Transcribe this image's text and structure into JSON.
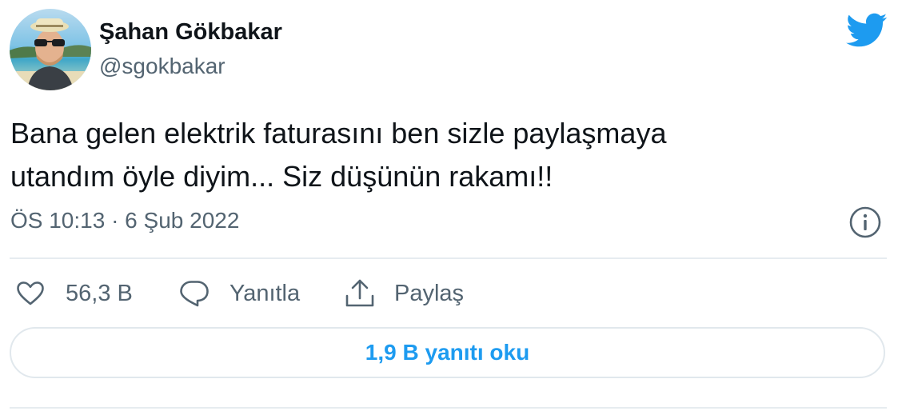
{
  "user": {
    "display_name": "Şahan Gökbakar",
    "handle": "@sgokbakar"
  },
  "tweet": {
    "text_lines": [
      "Bana gelen elektrik faturasını ben sizle paylaşmaya",
      "utandım öyle diyim... Siz düşünün rakamı!!"
    ],
    "timestamp": "ÖS 10:13 · 6 Şub 2022"
  },
  "actions": {
    "like_count": "56,3 B",
    "reply_label": "Yanıtla",
    "share_label": "Paylaş"
  },
  "read_replies_label": "1,9 B yanıtı oku",
  "colors": {
    "twitter_blue": "#1d9bf0",
    "text_primary": "#0f1419",
    "text_secondary": "#536471",
    "divider": "#e6ecf0"
  },
  "icons": {
    "brand": "twitter-bird-icon",
    "info": "info-icon",
    "like": "heart-icon",
    "reply": "speech-bubble-icon",
    "share": "share-icon"
  }
}
